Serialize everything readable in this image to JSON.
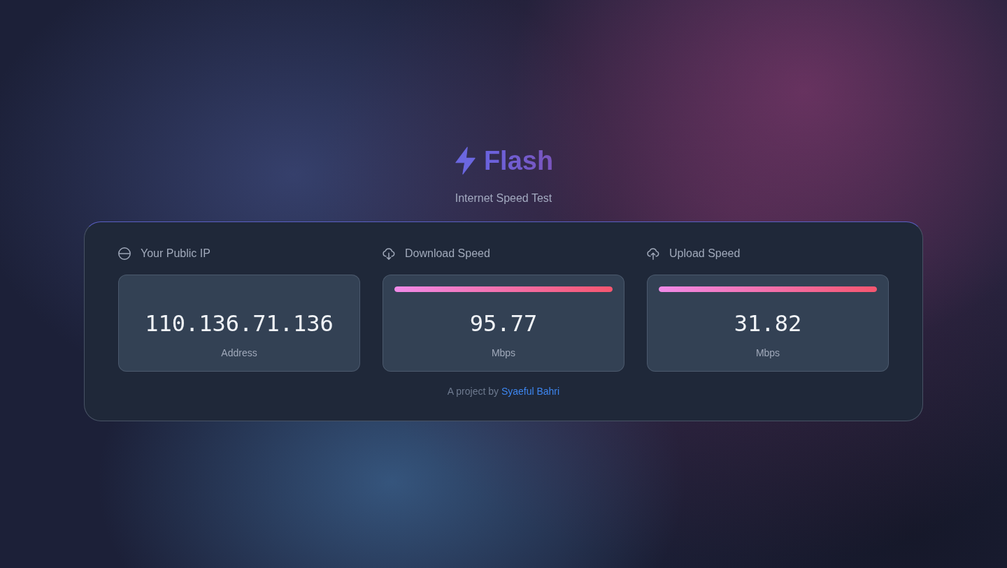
{
  "header": {
    "title": "Flash",
    "subtitle": "Internet Speed Test"
  },
  "metrics": [
    {
      "kind": "address",
      "label": "Your Public IP",
      "value": "110.136.71.136",
      "unit": "Address"
    },
    {
      "kind": "download",
      "label": "Download Speed",
      "value": "95.77",
      "unit": "Mbps",
      "level": 1
    },
    {
      "kind": "upload",
      "label": "Upload Speed",
      "value": "31.82",
      "unit": "Mbps",
      "level": 1
    }
  ],
  "footer": {
    "text": "A project by",
    "link": "Syaeful Bahri"
  }
}
